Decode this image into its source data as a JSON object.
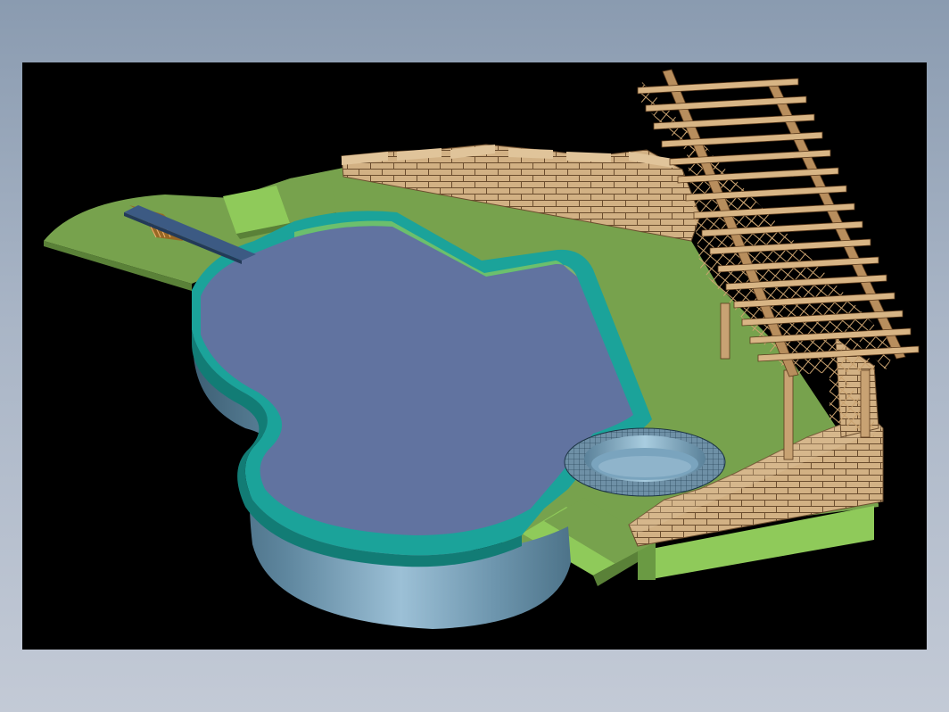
{
  "scene": {
    "subject": "pool",
    "colors": {
      "background_top": "#8a9bb0",
      "background_bottom": "#c3cad6",
      "viewport": "#000000",
      "lawn": "#77a24d",
      "lawn_light": "#8fca5a",
      "lawn_dark": "#5a8138",
      "water": "#6173a0",
      "coping": "#1ba39a",
      "coping_dark": "#127c75",
      "pool_wall": "#7fa7bf",
      "brick": "#d2b184",
      "brick_line": "#6b4d2e",
      "pergola": "#c8a273",
      "diving_board": "#3c5a83"
    },
    "elements": [
      {
        "name": "lawn",
        "icon": "lawn-icon"
      },
      {
        "name": "pool",
        "icon": "pool-icon"
      },
      {
        "name": "spa",
        "icon": "spa-icon"
      },
      {
        "name": "diving-board",
        "icon": "diving-board-icon"
      },
      {
        "name": "brick-wall",
        "icon": "brick-wall-icon"
      },
      {
        "name": "pergola",
        "icon": "pergola-icon"
      },
      {
        "name": "steps",
        "icon": "steps-icon"
      }
    ]
  }
}
